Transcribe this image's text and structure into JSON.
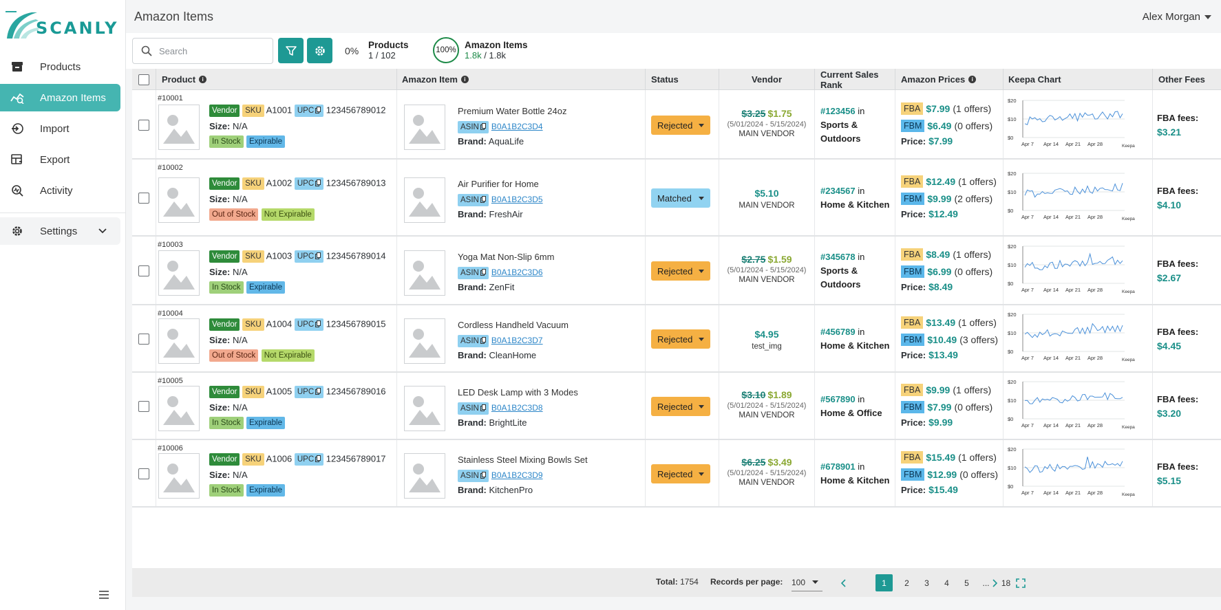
{
  "app": {
    "name": "SCANLY",
    "page_title": "Amazon Items",
    "user": "Alex Morgan"
  },
  "sidebar": {
    "items": [
      {
        "label": "Products",
        "icon": "archive-box-icon"
      },
      {
        "label": "Amazon Items",
        "icon": "trend-chart-icon",
        "active": true
      },
      {
        "label": "Import",
        "icon": "import-icon"
      },
      {
        "label": "Export",
        "icon": "table-export-icon"
      },
      {
        "label": "Activity",
        "icon": "activity-search-icon"
      }
    ],
    "settings": {
      "label": "Settings",
      "icon": "gear-icon"
    }
  },
  "toolbar": {
    "search_placeholder": "Search",
    "products_pct": "0%",
    "products_label": "Products",
    "products_count": "1 / 102",
    "amazon_pct": "100%",
    "amazon_label": "Amazon Items",
    "amazon_done": "1.8k",
    "amazon_total": " / 1.8k"
  },
  "columns": {
    "product": "Product",
    "amazon_item": "Amazon Item",
    "status": "Status",
    "vendor": "Vendor",
    "rank": "Current Sales Rank",
    "prices": "Amazon Prices",
    "keepa": "Keepa Chart",
    "fees": "Other Fees"
  },
  "labels": {
    "vendor_tag": "Vendor",
    "sku_tag": "SKU",
    "upc_tag": "UPC",
    "asin_tag": "ASIN",
    "size": "Size:",
    "brand": "Brand:",
    "in": "in",
    "price": "Price:",
    "fba": "FBA",
    "fbm": "FBM",
    "fba_fees": "FBA fees:",
    "keepa": "Keepa",
    "keepa_y": [
      "$20",
      "$10",
      "$0"
    ],
    "keepa_x": [
      "Apr 7",
      "Apr 14",
      "Apr 21",
      "Apr 28"
    ]
  },
  "rows": [
    {
      "id": "#10001",
      "sku": "A1001",
      "upc": "123456789012",
      "size": "N/A",
      "stock": "In Stock",
      "exp": "Expirable",
      "name": "Premium Water Bottle 24oz",
      "asin": "B0A1B2C3D4",
      "brand": "AquaLife",
      "status": "Rejected",
      "vendor_old": "$3.25",
      "vendor_new": "$1.75",
      "vendor_dates": "(5/01/2024 - 5/15/2024)",
      "vendor_name": "MAIN VENDOR",
      "rank": "#123456",
      "cat1": "Sports &",
      "cat2": "Outdoors",
      "fba_price": "$7.99",
      "fba_offers": "(1 offers)",
      "fbm_price": "$6.49",
      "fbm_offers": "(0 offers)",
      "price": "$7.99",
      "fees": "$3.21"
    },
    {
      "id": "#10002",
      "sku": "A1002",
      "upc": "123456789013",
      "size": "N/A",
      "stock": "Out of Stock",
      "exp": "Not Expirable",
      "name": "Air Purifier for Home",
      "asin": "B0A1B2C3D5",
      "brand": "FreshAir",
      "status": "Matched",
      "vendor_single": "$5.10",
      "vendor_name": "MAIN VENDOR",
      "rank": "#234567",
      "cat1": "Home & Kitchen",
      "cat2": "",
      "fba_price": "$12.49",
      "fba_offers": "(1 offers)",
      "fbm_price": "$9.99",
      "fbm_offers": "(2 offers)",
      "price": "$12.49",
      "fees": "$4.10"
    },
    {
      "id": "#10003",
      "sku": "A1003",
      "upc": "123456789014",
      "size": "N/A",
      "stock": "In Stock",
      "exp": "Expirable",
      "name": "Yoga Mat Non-Slip 6mm",
      "asin": "B0A1B2C3D6",
      "brand": "ZenFit",
      "status": "Rejected",
      "vendor_old": "$2.75",
      "vendor_new": "$1.59",
      "vendor_dates": "(5/01/2024 - 5/15/2024)",
      "vendor_name": "MAIN VENDOR",
      "rank": "#345678",
      "cat1": "Sports &",
      "cat2": "Outdoors",
      "fba_price": "$8.49",
      "fba_offers": "(1 offers)",
      "fbm_price": "$6.99",
      "fbm_offers": "(0 offers)",
      "price": "$8.49",
      "fees": "$2.67"
    },
    {
      "id": "#10004",
      "sku": "A1004",
      "upc": "123456789015",
      "size": "N/A",
      "stock": "Out of Stock",
      "exp": "Not Expirable",
      "name": "Cordless Handheld Vacuum",
      "asin": "B0A1B2C3D7",
      "brand": "CleanHome",
      "status": "Rejected",
      "vendor_single": "$4.95",
      "vendor_name": "test_img",
      "rank": "#456789",
      "cat1": "Home & Kitchen",
      "cat2": "",
      "fba_price": "$13.49",
      "fba_offers": "(1 offers)",
      "fbm_price": "$10.49",
      "fbm_offers": "(3 offers)",
      "price": "$13.49",
      "fees": "$4.45"
    },
    {
      "id": "#10005",
      "sku": "A1005",
      "upc": "123456789016",
      "size": "N/A",
      "stock": "In Stock",
      "exp": "Expirable",
      "name": "LED Desk Lamp with 3 Modes",
      "asin": "B0A1B2C3D8",
      "brand": "BrightLite",
      "status": "Rejected",
      "vendor_old": "$3.10",
      "vendor_new": "$1.89",
      "vendor_dates": "(5/01/2024 - 5/15/2024)",
      "vendor_name": "MAIN VENDOR",
      "rank": "#567890",
      "cat1": "Home & Office",
      "cat2": "",
      "fba_price": "$9.99",
      "fba_offers": "(1 offers)",
      "fbm_price": "$7.99",
      "fbm_offers": "(0 offers)",
      "price": "$9.99",
      "fees": "$3.20"
    },
    {
      "id": "#10006",
      "sku": "A1006",
      "upc": "123456789017",
      "size": "N/A",
      "stock": "In Stock",
      "exp": "Expirable",
      "name": "Stainless Steel Mixing Bowls Set",
      "asin": "B0A1B2C3D9",
      "brand": "KitchenPro",
      "status": "Rejected",
      "vendor_old": "$6.25",
      "vendor_new": "$3.49",
      "vendor_dates": "(5/01/2024 - 5/15/2024)",
      "vendor_name": "MAIN VENDOR",
      "rank": "#678901",
      "cat1": "Home & Kitchen",
      "cat2": "",
      "fba_price": "$15.49",
      "fba_offers": "(1 offers)",
      "fbm_price": "$12.99",
      "fbm_offers": "(0 offers)",
      "price": "$15.49",
      "fees": "$5.15"
    }
  ],
  "footer": {
    "total_label": "Total:",
    "total": "1754",
    "rpp_label": "Records per page:",
    "rpp": "100",
    "pages": [
      "1",
      "2",
      "3",
      "4",
      "5",
      "...",
      "18"
    ],
    "current_page": "1"
  },
  "colors": {
    "accent": "#1e9994",
    "active_nav": "#45b5b1",
    "rejected": "#f5b043",
    "matched": "#91d3f1"
  }
}
